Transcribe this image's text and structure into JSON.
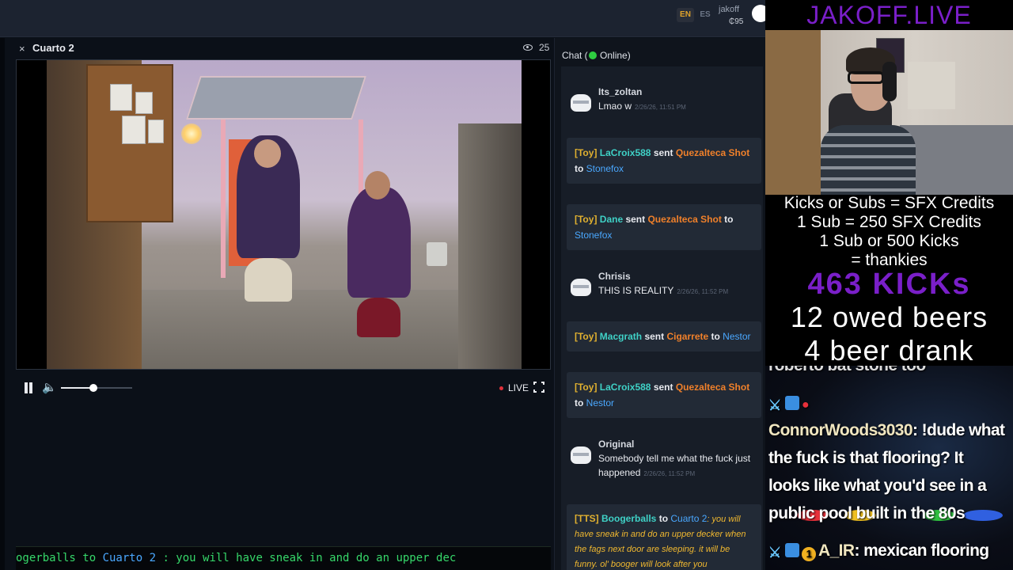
{
  "topbar": {
    "lang_en": "EN",
    "lang_es": "ES",
    "username": "jakoff",
    "balance": "₵95"
  },
  "room": {
    "title": "Cuarto 2",
    "viewers": "25",
    "close": "×",
    "live_label": "LIVE",
    "volume_level": 0.45
  },
  "ticker": {
    "prefix": "ogerballs",
    "to": " to ",
    "target": "Cuarto 2",
    "message": " : you will have sneak in and do an upper dec"
  },
  "chat": {
    "header_before": "Chat (",
    "header_after": " Online)",
    "messages": [
      {
        "user": "Its_zoltan",
        "text": "Lmao w",
        "time": "2/26/26, 11:51 PM"
      },
      {
        "tag": "[Toy]",
        "user": "LaCroix588",
        "verb": " sent ",
        "item": "Quezalteca Shot",
        "to": " to ",
        "target": "Stonefox"
      },
      {
        "tag": "[Toy]",
        "user": "Dane",
        "verb": " sent ",
        "item": "Quezalteca Shot",
        "to": " to ",
        "target": "Stonefox"
      },
      {
        "user": "Chrisis",
        "text": "THIS IS REALITY",
        "time": "2/26/26, 11:52 PM"
      },
      {
        "tag": "[Toy]",
        "user": "Macgrath",
        "verb": " sent ",
        "item": "Cigarrete",
        "to": " to ",
        "target": "Nestor"
      },
      {
        "tag": "[Toy]",
        "user": "LaCroix588",
        "verb": " sent ",
        "item": "Quezalteca Shot",
        "to": " to ",
        "target": "Nestor"
      },
      {
        "user": "Original",
        "text": "Somebody tell me what the fuck just happened",
        "time": "2/26/26, 11:52 PM"
      },
      {
        "tag": "[TTS]",
        "user": "Boogerballs",
        "to": " to ",
        "target": "Cuarto 2",
        "text": ": you will have sneak in and do an upper decker when the fags next door are sleeping. it will be funny. ol' booger will look after you"
      }
    ]
  },
  "overlay": {
    "brand": "JAKOFF.LIVE",
    "line1": "Kicks or Subs = SFX Credits",
    "line2": "1 Sub = 250 SFX Credits",
    "line3": "1 Sub or 500 Kicks",
    "line4": "= thankies",
    "kicks": "463 KICKs",
    "owed": "12 owed beers",
    "drank": "4 beer drank",
    "chat": {
      "partial": "roberto bat stone too",
      "user1": "ConnorWoods3030",
      "msg1_l1": "!dude what",
      "msg1_l2": "the fuck is that flooring? It",
      "msg1_l3": "looks like what you'd see in a",
      "msg1_l4": "public pool built in the 80s",
      "badge_num": "1",
      "user2": "A_IR",
      "msg2": "mexican flooring"
    }
  },
  "colors": {
    "accent_purple": "#7a1fc9",
    "live_red": "#e0303a",
    "online_green": "#2ecc40",
    "gift_user": "#3fd1c6",
    "gift_item": "#f0802a",
    "gift_target": "#4aa8ff",
    "tag_gold": "#e0b030"
  },
  "icons": [
    "close-icon",
    "eye-icon",
    "pause-icon",
    "volume-icon",
    "fullscreen-icon",
    "avatar-icon",
    "online-dot"
  ]
}
